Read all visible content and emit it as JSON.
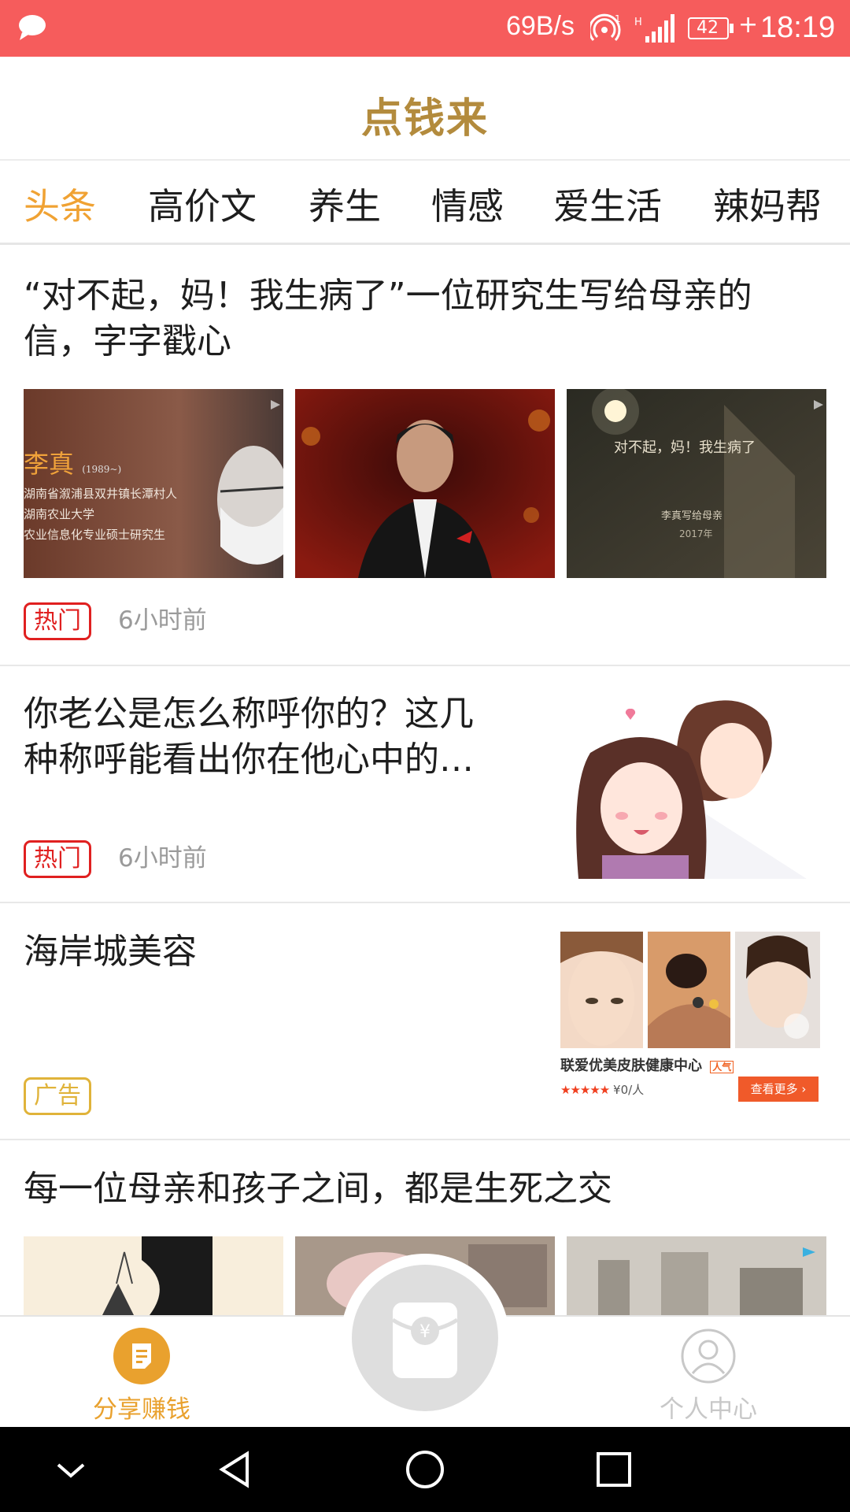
{
  "status_bar": {
    "net_speed": "69B/s",
    "battery": "42",
    "time": "18:19",
    "bg_color": "#f65c5c"
  },
  "app": {
    "title": "点钱来",
    "title_color": "#b38b3d"
  },
  "tabs": [
    {
      "label": "头条",
      "active": true
    },
    {
      "label": "高价文",
      "active": false
    },
    {
      "label": "养生",
      "active": false
    },
    {
      "label": "情感",
      "active": false
    },
    {
      "label": "爱生活",
      "active": false
    },
    {
      "label": "辣妈帮",
      "active": false
    }
  ],
  "articles": [
    {
      "title_lines": [
        "“对不起，妈！我生病了”一位研究生写给母亲的",
        "信，字字戳心"
      ],
      "badge": "热门",
      "time": "6小时前",
      "images": [
        {
          "caption_name": "李真",
          "caption_years": "(1989~)",
          "caption_lines": [
            "湖南省溆浦县双井镇长潭村人",
            "湖南农业大学",
            "农业信息化专业硕士研究生"
          ]
        },
        {
          "caption": ""
        },
        {
          "caption_line1": "对不起，妈！我生病了",
          "caption_line2": "李真写给母亲",
          "caption_line3": "2017年"
        }
      ]
    },
    {
      "title_lines": [
        "你老公是怎么称呼你的？这几",
        "种称呼能看出你在他心中的…"
      ],
      "badge": "热门",
      "time": "6小时前"
    },
    {
      "title_lines": [
        "海岸城美容"
      ],
      "badge": "广告",
      "ad": {
        "shop_name": "联爱优美皮肤健康中心",
        "popularity_tag": "人气",
        "price": "¥0/人",
        "more_button": "查看更多 ›",
        "rating": 5
      }
    },
    {
      "title_lines": [
        "每一位母亲和孩子之间，都是生死之交"
      ]
    }
  ],
  "bottom_nav": {
    "left_label": "分享赚钱",
    "right_label": "个人中心",
    "active_color": "#e9a12e",
    "inactive_color": "#c8c8c8"
  }
}
